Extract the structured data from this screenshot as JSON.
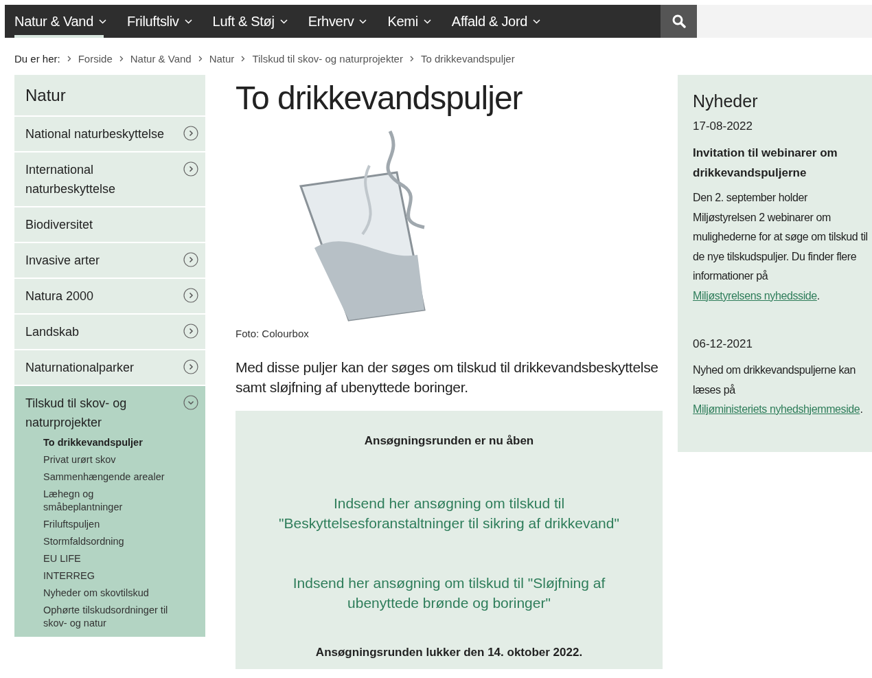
{
  "nav": {
    "items": [
      {
        "label": "Natur & Vand",
        "selected": true
      },
      {
        "label": "Friluftsliv",
        "selected": false
      },
      {
        "label": "Luft & Støj",
        "selected": false
      },
      {
        "label": "Erhverv",
        "selected": false
      },
      {
        "label": "Kemi",
        "selected": false
      },
      {
        "label": "Affald & Jord",
        "selected": false
      }
    ]
  },
  "breadcrumb": {
    "label": "Du er her:",
    "items": [
      "Forside",
      "Natur & Vand",
      "Natur",
      "Tilskud til skov- og naturprojekter",
      "To drikkevandspuljer"
    ]
  },
  "sidebar": {
    "title": "Natur",
    "items": [
      {
        "label": "National naturbeskyttelse",
        "expandable": true,
        "expanded": false
      },
      {
        "label": "International naturbeskyttelse",
        "expandable": true,
        "expanded": false
      },
      {
        "label": "Biodiversitet",
        "expandable": false,
        "expanded": false
      },
      {
        "label": "Invasive arter",
        "expandable": true,
        "expanded": false
      },
      {
        "label": "Natura 2000",
        "expandable": true,
        "expanded": false
      },
      {
        "label": "Landskab",
        "expandable": true,
        "expanded": false
      },
      {
        "label": "Naturnationalparker",
        "expandable": true,
        "expanded": false
      },
      {
        "label": "Tilskud til skov- og naturprojekter",
        "expandable": true,
        "expanded": true,
        "children": [
          {
            "label": "To drikkevandspuljer",
            "selected": true
          },
          {
            "label": "Privat urørt skov",
            "selected": false
          },
          {
            "label": "Sammenhængende arealer",
            "selected": false
          },
          {
            "label": "Læhegn og småbeplantninger",
            "selected": false
          },
          {
            "label": "Friluftspuljen",
            "selected": false
          },
          {
            "label": "Stormfaldsordning",
            "selected": false
          },
          {
            "label": "EU LIFE",
            "selected": false
          },
          {
            "label": "INTERREG",
            "selected": false
          },
          {
            "label": "Nyheder om skovtilskud",
            "selected": false
          },
          {
            "label": "Ophørte tilskudsordninger til skov- og natur",
            "selected": false
          }
        ]
      }
    ]
  },
  "article": {
    "title": "To drikkevandspuljer",
    "photo_caption": "Foto: Colourbox",
    "lead": "Med disse puljer kan der søges om tilskud til drikkevandsbeskyttelse samt sløjfning af ubenyttede boringer.",
    "box": {
      "heading": "Ansøgningsrunden er nu åben",
      "links": [
        "Indsend her ansøgning om tilskud til \"Beskyttelsesforanstaltninger til sikring af drikkevand\"",
        "Indsend her ansøgning om tilskud til \"Sløjfning af ubenyttede brønde og boringer\""
      ],
      "footer": "Ansøgningsrunden lukker den 14. oktober 2022."
    }
  },
  "news": {
    "title": "Nyheder",
    "items": [
      {
        "date": "17-08-2022",
        "headline": "Invitation til webinarer om drikkevandspuljerne",
        "text_before": "Den 2. september holder Miljøstyrelsen 2 webinarer om mulighederne for at søge om tilskud til de nye tilskudspuljer. Du finder flere informationer på ",
        "link": "Miljøstyrelsens nyhedsside",
        "text_after": "."
      },
      {
        "date": "06-12-2021",
        "text_before": "Nyhed om drikkevandspuljerne kan læses på ",
        "link": "Miljøministeriets nyhedshjemmeside",
        "text_after": "."
      }
    ]
  }
}
